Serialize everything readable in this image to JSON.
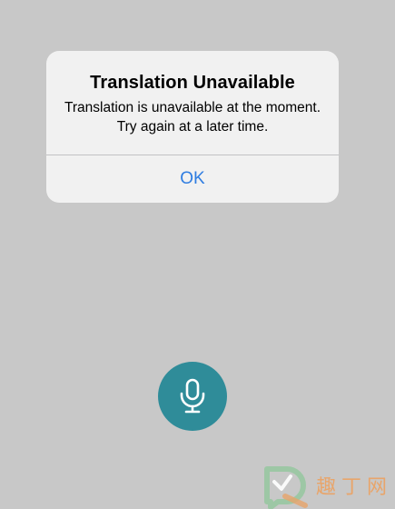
{
  "alert": {
    "title": "Translation Unavailable",
    "message": "Translation is unavailable at the moment. Try again at a later time.",
    "ok_label": "OK"
  },
  "mic": {
    "icon": "microphone-icon"
  },
  "watermark": {
    "text": "趣丁网"
  },
  "colors": {
    "background": "#c8c8c8",
    "alert_bg": "#f1f1f1",
    "button_blue": "#2f7de1",
    "mic_teal": "#2f8c99"
  }
}
